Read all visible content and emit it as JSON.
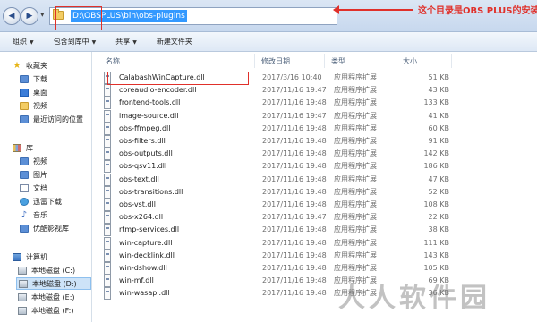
{
  "address": {
    "path": "D:\\OBSPLUS\\bin\\obs-plugins",
    "annotation": "这个目录是OBS PLUS的安装目录"
  },
  "toolbar": {
    "organize": "组织",
    "include_in_library": "包含到库中",
    "share": "共享",
    "new_folder": "新建文件夹"
  },
  "nav": {
    "favorites": "收藏夹",
    "favorites_items": [
      "下载",
      "桌面",
      "视频",
      "最近访问的位置"
    ],
    "libraries": "库",
    "library_items": [
      "视频",
      "图片",
      "文档",
      "迅雷下载",
      "音乐",
      "优酷影视库"
    ],
    "computer": "计算机",
    "drives": [
      "本地磁盘 (C:)",
      "本地磁盘 (D:)",
      "本地磁盘 (E:)",
      "本地磁盘 (F:)"
    ]
  },
  "columns": {
    "name": "名称",
    "date": "修改日期",
    "type": "类型",
    "size": "大小"
  },
  "files": [
    {
      "name": "CalabashWinCapture.dll",
      "date": "2017/3/16 10:40",
      "type": "应用程序扩展",
      "size": "51 KB"
    },
    {
      "name": "coreaudio-encoder.dll",
      "date": "2017/11/16 19:47",
      "type": "应用程序扩展",
      "size": "43 KB"
    },
    {
      "name": "frontend-tools.dll",
      "date": "2017/11/16 19:48",
      "type": "应用程序扩展",
      "size": "133 KB"
    },
    {
      "name": "image-source.dll",
      "date": "2017/11/16 19:47",
      "type": "应用程序扩展",
      "size": "41 KB"
    },
    {
      "name": "obs-ffmpeg.dll",
      "date": "2017/11/16 19:48",
      "type": "应用程序扩展",
      "size": "60 KB"
    },
    {
      "name": "obs-filters.dll",
      "date": "2017/11/16 19:48",
      "type": "应用程序扩展",
      "size": "91 KB"
    },
    {
      "name": "obs-outputs.dll",
      "date": "2017/11/16 19:48",
      "type": "应用程序扩展",
      "size": "142 KB"
    },
    {
      "name": "obs-qsv11.dll",
      "date": "2017/11/16 19:48",
      "type": "应用程序扩展",
      "size": "186 KB"
    },
    {
      "name": "obs-text.dll",
      "date": "2017/11/16 19:48",
      "type": "应用程序扩展",
      "size": "47 KB"
    },
    {
      "name": "obs-transitions.dll",
      "date": "2017/11/16 19:48",
      "type": "应用程序扩展",
      "size": "52 KB"
    },
    {
      "name": "obs-vst.dll",
      "date": "2017/11/16 19:48",
      "type": "应用程序扩展",
      "size": "108 KB"
    },
    {
      "name": "obs-x264.dll",
      "date": "2017/11/16 19:47",
      "type": "应用程序扩展",
      "size": "22 KB"
    },
    {
      "name": "rtmp-services.dll",
      "date": "2017/11/16 19:48",
      "type": "应用程序扩展",
      "size": "38 KB"
    },
    {
      "name": "win-capture.dll",
      "date": "2017/11/16 19:48",
      "type": "应用程序扩展",
      "size": "111 KB"
    },
    {
      "name": "win-decklink.dll",
      "date": "2017/11/16 19:48",
      "type": "应用程序扩展",
      "size": "143 KB"
    },
    {
      "name": "win-dshow.dll",
      "date": "2017/11/16 19:48",
      "type": "应用程序扩展",
      "size": "105 KB"
    },
    {
      "name": "win-mf.dll",
      "date": "2017/11/16 19:48",
      "type": "应用程序扩展",
      "size": "69 KB"
    },
    {
      "name": "win-wasapi.dll",
      "date": "2017/11/16 19:48",
      "type": "应用程序扩展",
      "size": "36 KB"
    }
  ],
  "watermark": "人人软件园",
  "colors": {
    "annotation": "#e0302a",
    "selection": "#3399ff",
    "column_header": "#4c607a"
  }
}
